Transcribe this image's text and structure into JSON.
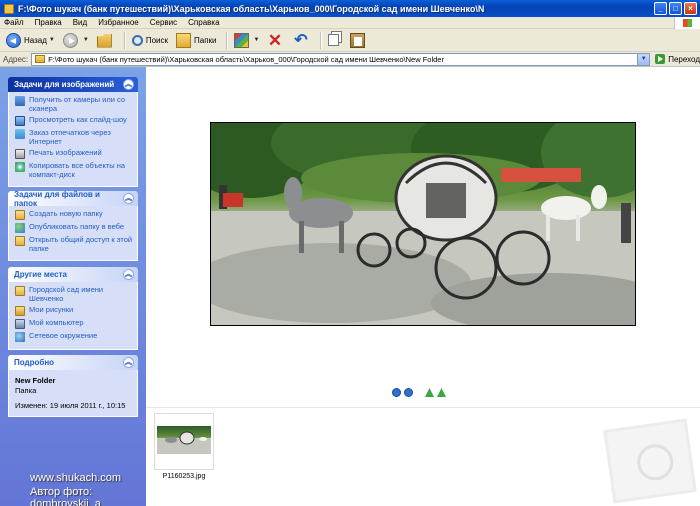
{
  "window": {
    "title": "F:\\Фото шукач (банк путешествий)\\Харьковская область\\Харьков_000\\Городской сад имени Шевченко\\N"
  },
  "menu": [
    "Файл",
    "Правка",
    "Вид",
    "Избранное",
    "Сервис",
    "Справка"
  ],
  "toolbar": {
    "back_label": "Назад",
    "search_label": "Поиск",
    "folders_label": "Папки"
  },
  "address": {
    "label": "Адрес:",
    "value": "F:\\Фото шукач (банк путешествий)\\Харьковская область\\Харьков_000\\Городской сад имени Шевченко\\New Folder",
    "go_label": "Переход"
  },
  "panels": {
    "image_tasks": {
      "title": "Задачи для изображений",
      "items": [
        "Получить от камеры или со сканера",
        "Просмотреть как слайд-шоу",
        "Заказ отпечатков через Интернет",
        "Печать изображений",
        "Копировать все объекты на компакт-диск"
      ]
    },
    "file_tasks": {
      "title": "Задачи для файлов и папок",
      "items": [
        "Создать новую папку",
        "Опубликовать папку в вебе",
        "Открыть общий доступ к этой папке"
      ]
    },
    "other_places": {
      "title": "Другие места",
      "items": [
        "Городской сад имени Шевченко",
        "Мои рисунки",
        "Мой компьютер",
        "Сетевое окружение"
      ]
    },
    "details": {
      "title": "Подробно",
      "name": "New Folder",
      "type": "Папка",
      "modified": "Изменен: 19 июля 2011 г., 10:15"
    }
  },
  "watermark": {
    "line1": "www.shukach.com",
    "line2": "Автор фото: dombrovskii_a"
  },
  "filmstrip": {
    "thumb_label": "P1160253.jpg"
  }
}
